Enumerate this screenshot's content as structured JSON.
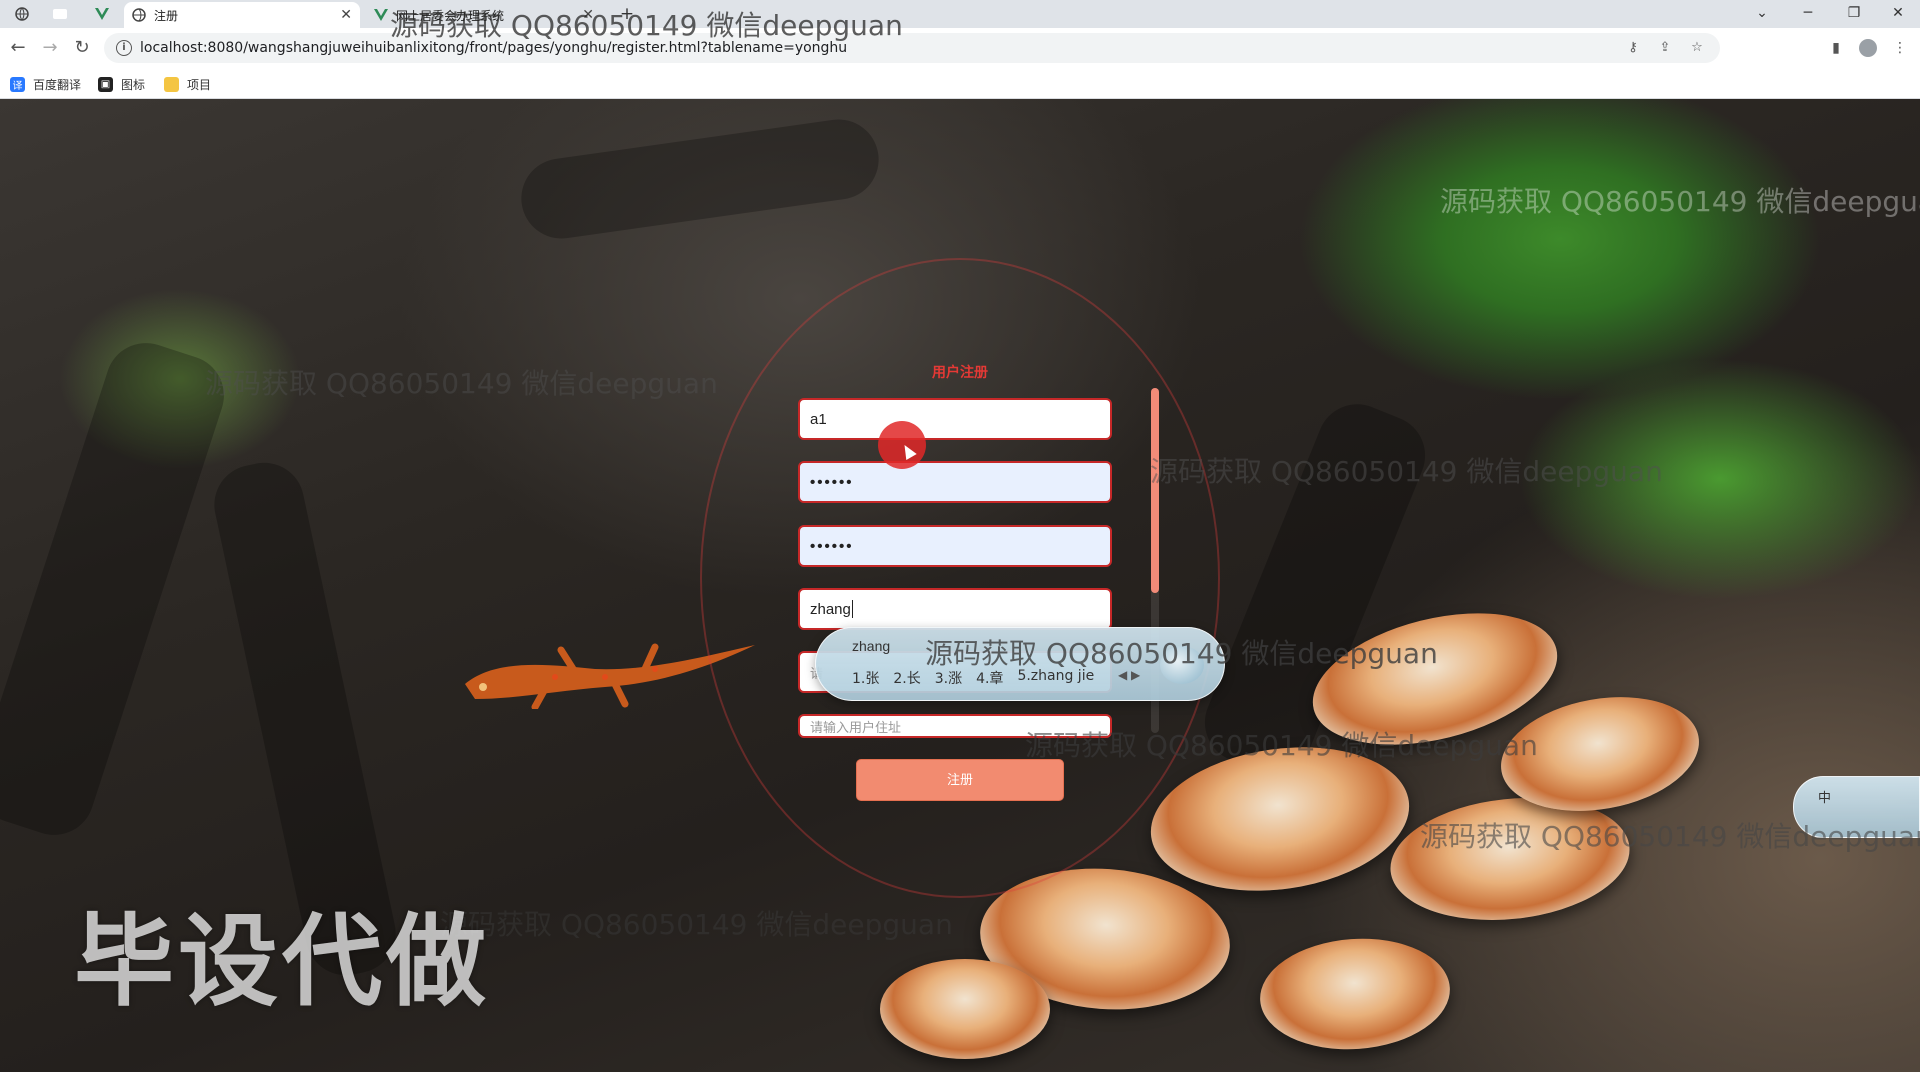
{
  "browser": {
    "tabs": [
      {
        "label": "注册",
        "active": true
      },
      {
        "label": "网上居委会办理系统",
        "active": false
      }
    ],
    "address": "localhost:8080/wangshangjuweihuibanlixitong/front/pages/yonghu/register.html?tablename=yonghu",
    "bookmarks": [
      {
        "label": "百度翻译",
        "icon": "translate-icon",
        "color": "#2979ff"
      },
      {
        "label": "图标",
        "icon": "image-icon",
        "color": "#222222"
      },
      {
        "label": "项目",
        "icon": "folder-icon",
        "color": "#f4c542"
      }
    ]
  },
  "form": {
    "title": "用户注册",
    "fields": {
      "account": "a1",
      "password": "••••••",
      "confirm_password": "••••••",
      "name": "zhang",
      "hidden_partial": "请",
      "last_placeholder": "请输入用户住址"
    },
    "submit_label": "注册"
  },
  "ime": {
    "composition": "zhang",
    "candidates": [
      "1.张",
      "2.长",
      "3.涨",
      "4.章",
      "5.zhang jie"
    ],
    "status_mode": "中"
  },
  "watermarks": {
    "top": "源码获取 QQ86050149 微信deepguan",
    "repeat": "源码获取 QQ86050149 微信deepguan",
    "stamp": "毕设代做"
  },
  "colors": {
    "accent": "#e53935",
    "button": "#f28b70",
    "field_border": "#c62828"
  }
}
